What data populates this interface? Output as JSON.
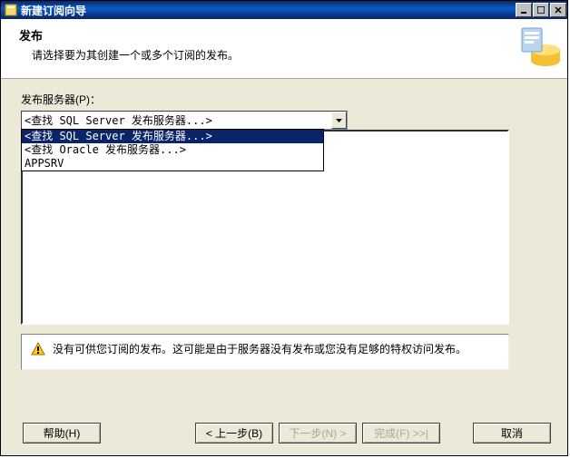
{
  "window": {
    "title": "新建订阅向导"
  },
  "header": {
    "heading": "发布",
    "subtext": "请选择要为其创建一个或多个订阅的发布。"
  },
  "form": {
    "server_label": "发布服务器(P)：",
    "combo_value": "<查找 SQL Server 发布服务器...>",
    "dropdown_options": [
      "<查找 SQL Server 发布服务器...>",
      "<查找 Oracle 发布服务器...>",
      "APPSRV"
    ],
    "selected_index": 0
  },
  "warning": {
    "text": "没有可供您订阅的发布。这可能是由于服务器没有发布或您没有足够的特权访问发布。"
  },
  "buttons": {
    "help": "帮助(H)",
    "back": "< 上一步(B)",
    "next": "下一步(N) >",
    "finish": "完成(F) >>|",
    "cancel": "取消"
  },
  "icons": {
    "app": "wizard-icon",
    "minimize": "minimize-icon",
    "maximize": "maximize-icon",
    "close": "close-icon",
    "dropdown": "chevron-down-icon",
    "warning": "warning-icon",
    "header_graphic": "db-banner-icon"
  }
}
